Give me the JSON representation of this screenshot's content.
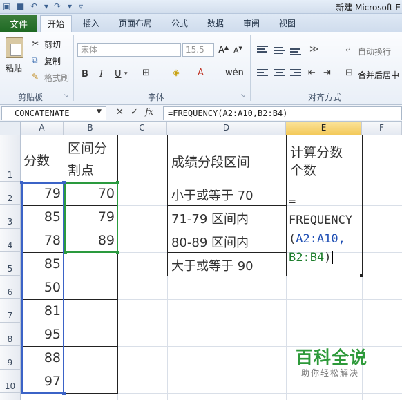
{
  "window": {
    "title": "新建 Microsoft E"
  },
  "quick_access": {
    "icons": [
      "excel-icon",
      "save-icon",
      "undo-icon",
      "redo-icon",
      "customize-icon"
    ]
  },
  "tabs": {
    "file": "文件",
    "home": "开始",
    "insert": "插入",
    "layout": "页面布局",
    "formulas": "公式",
    "data": "数据",
    "review": "审阅",
    "view": "视图"
  },
  "ribbon": {
    "clipboard": {
      "paste": "粘贴",
      "cut": "剪切",
      "copy": "复制",
      "format_painter": "格式刷",
      "group_label": "剪贴板"
    },
    "font": {
      "font_name": "宋体",
      "font_size": "15.5",
      "bold": "B",
      "italic": "I",
      "underline": "U",
      "group_label": "字体"
    },
    "alignment": {
      "wrap_text": "自动换行",
      "merge_center": "合并后居中",
      "group_label": "对齐方式"
    }
  },
  "formula_bar": {
    "name_box": "CONCATENATE",
    "fx": "fx",
    "formula": "=FREQUENCY(A2:A10,B2:B4)"
  },
  "columns": [
    "A",
    "B",
    "C",
    "D",
    "E",
    "F"
  ],
  "selected_column": "E",
  "rows": [
    "1",
    "2",
    "3",
    "4",
    "5",
    "6",
    "7",
    "8",
    "9",
    "10"
  ],
  "cells": {
    "A1": "分数",
    "B1_line1": "区间分",
    "B1_line2": "割点",
    "D1": "成绩分段区间",
    "E1_line1": "计算分数",
    "E1_line2": "个数",
    "A": [
      "79",
      "85",
      "78",
      "85",
      "50",
      "81",
      "95",
      "88",
      "97"
    ],
    "B": [
      "70",
      "79",
      "89"
    ],
    "D": [
      "小于或等于 70",
      "71-79 区间内",
      "80-89 区间内",
      "大于或等于 90"
    ],
    "E2": {
      "line1": "=",
      "line2": "FREQUENCY",
      "line3_paren": "(",
      "line3_ref": "A2:A10,",
      "line4_ref": "B2:B4",
      "line4_paren": ")"
    }
  },
  "colors": {
    "ref_a": "#1f4fb4",
    "ref_b": "#1c7d2b",
    "accent_file_tab": "#1f6a24",
    "selected_header": "#f3c95a"
  },
  "watermark": {
    "main": "百科全说",
    "sub": "助你轻松解决"
  }
}
